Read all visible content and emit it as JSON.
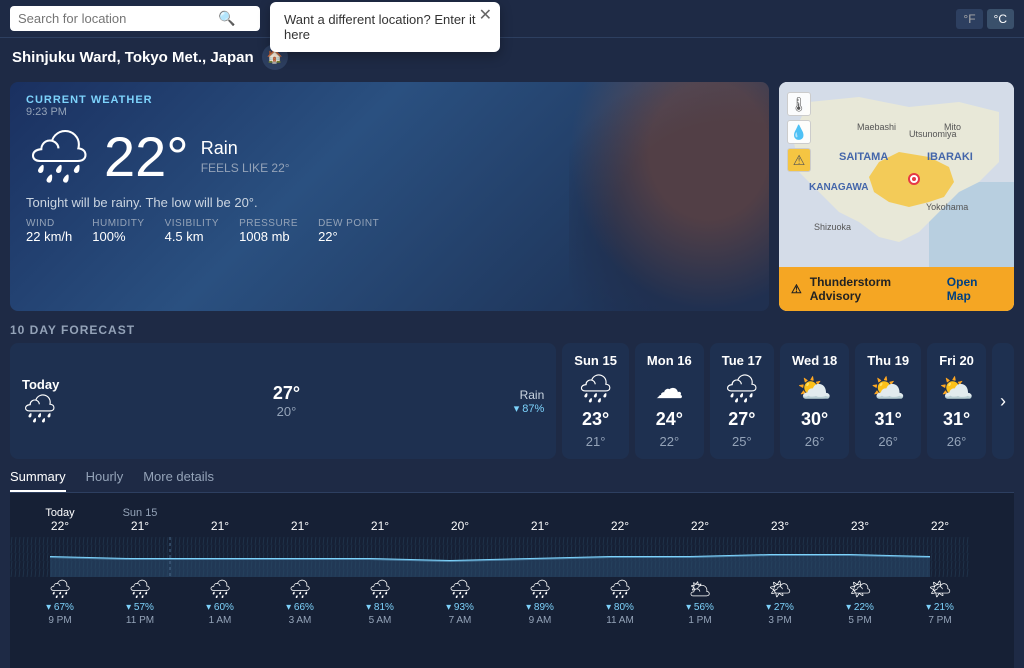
{
  "topbar": {
    "search_placeholder": "Search for location",
    "unit_f": "°F",
    "unit_c": "°C"
  },
  "tooltip": {
    "text": "Want a different location? Enter it here"
  },
  "location": {
    "name": "Shinjuku Ward, Tokyo Met., Japan"
  },
  "current_weather": {
    "label": "CURRENT WEATHER",
    "time": "9:23 PM",
    "temp": "22°",
    "condition": "Rain",
    "feels_like_label": "FEELS LIKE",
    "feels_like": "22°",
    "description": "Tonight will be rainy. The low will be 20°.",
    "wind_label": "WIND",
    "wind_value": "22 km/h",
    "humidity_label": "HUMIDITY",
    "humidity_value": "100%",
    "visibility_label": "VISIBILITY",
    "visibility_value": "4.5 km",
    "pressure_label": "PRESSURE",
    "pressure_value": "1008 mb",
    "dew_point_label": "DEW POINT",
    "dew_point_value": "22°"
  },
  "map": {
    "alert_text": "Thunderstorm Advisory",
    "open_map_label": "Open Map"
  },
  "forecast": {
    "section_title": "10 DAY FORECAST",
    "days": [
      {
        "day": "Today",
        "high": "27°",
        "low": "20°",
        "condition": "Rain",
        "precip": "▾ 87%",
        "icon": "🌧"
      },
      {
        "day": "Sun 15",
        "high": "23°",
        "low": "21°",
        "condition": "",
        "precip": "",
        "icon": "🌧"
      },
      {
        "day": "Mon 16",
        "high": "24°",
        "low": "22°",
        "condition": "",
        "precip": "",
        "icon": "☁"
      },
      {
        "day": "Tue 17",
        "high": "27°",
        "low": "25°",
        "condition": "",
        "precip": "",
        "icon": "🌧"
      },
      {
        "day": "Wed 18",
        "high": "30°",
        "low": "26°",
        "condition": "",
        "precip": "",
        "icon": "⛅"
      },
      {
        "day": "Thu 19",
        "high": "31°",
        "low": "26°",
        "condition": "",
        "precip": "",
        "icon": "⛅"
      },
      {
        "day": "Fri 20",
        "high": "31°",
        "low": "26°",
        "condition": "",
        "precip": "",
        "icon": "⛅"
      }
    ],
    "nav_next": "›"
  },
  "tabs": [
    {
      "id": "summary",
      "label": "Summary",
      "active": true
    },
    {
      "id": "hourly",
      "label": "Hourly",
      "active": false
    },
    {
      "id": "more",
      "label": "More details",
      "active": false
    }
  ],
  "hourly_chart": {
    "day_labels": [
      "Today",
      "Sun 15"
    ],
    "temps": [
      "22°",
      "21°",
      "21°",
      "21°",
      "21°",
      "20°",
      "21°",
      "22°",
      "22°",
      "23°",
      "23°",
      "22°"
    ],
    "icons": [
      "🌧",
      "🌧",
      "🌧",
      "🌧",
      "🌧",
      "🌧",
      "🌧",
      "🌧",
      "🌥",
      "🌤",
      "🌤",
      "🌤"
    ],
    "precip": [
      "▾ 67%",
      "▾ 57%",
      "▾ 60%",
      "▾ 66%",
      "▾ 81%",
      "▾ 93%",
      "▾ 89%",
      "▾ 80%",
      "▾ 56%",
      "▾ 27%",
      "▾ 22%",
      "▾ 21%"
    ],
    "times": [
      "9 PM",
      "11 PM",
      "1 AM",
      "3 AM",
      "5 AM",
      "7 AM",
      "9 AM",
      "11 AM",
      "1 PM",
      "3 PM",
      "5 PM",
      "7 PM"
    ]
  }
}
